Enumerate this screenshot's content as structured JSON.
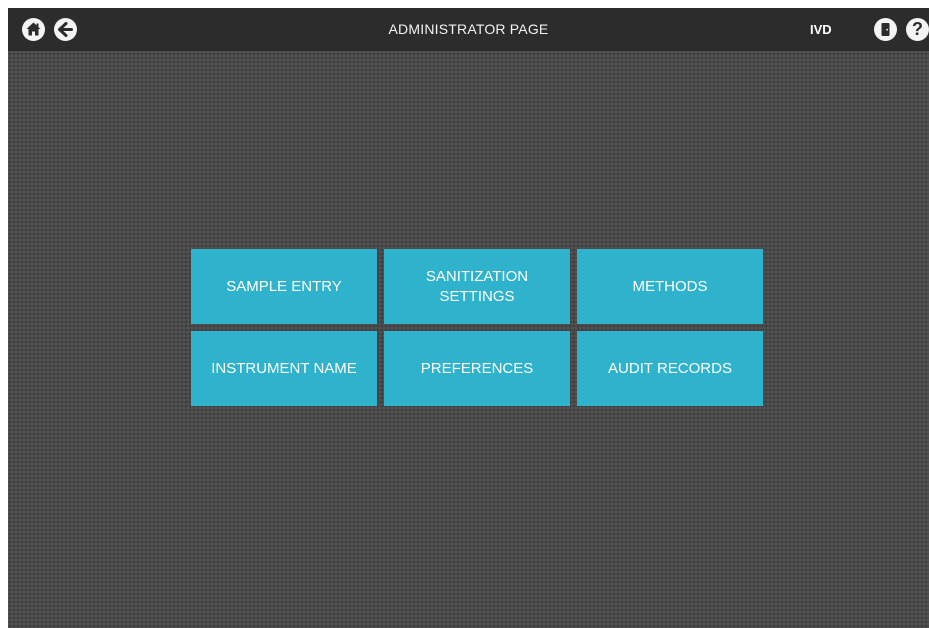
{
  "header": {
    "title": "ADMINISTRATOR PAGE",
    "mode_badge": "IVD",
    "help_glyph": "?",
    "icons": [
      "home-icon",
      "back-arrow-icon",
      "exit-door-icon",
      "help-icon"
    ]
  },
  "colors": {
    "topbar": "#2c2c2c",
    "background": "#4a4a4a",
    "tile": "#2fb2cb",
    "tile_text": "#ffffff"
  },
  "menu": {
    "tiles": [
      {
        "label": "SAMPLE ENTRY"
      },
      {
        "label": "SANITIZATION SETTINGS"
      },
      {
        "label": "METHODS"
      },
      {
        "label": "INSTRUMENT NAME"
      },
      {
        "label": "PREFERENCES"
      },
      {
        "label": "AUDIT RECORDS"
      }
    ]
  }
}
